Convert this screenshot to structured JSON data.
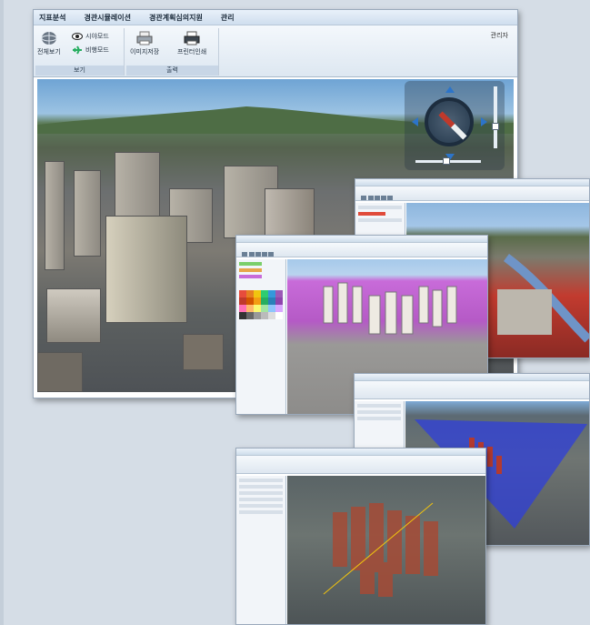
{
  "main_window": {
    "menu": [
      "지표분석",
      "경관시뮬레이션",
      "경관계획심의지원",
      "관리"
    ],
    "user_label": "관리자",
    "ribbon": {
      "view_group": {
        "caption": "보기",
        "full_view": "전체보기",
        "sight_mode": "시야모드",
        "flight_mode": "비행모드"
      },
      "output_group": {
        "caption": "출력",
        "save_image": "이미지저장",
        "print": "프린터인쇄"
      }
    }
  },
  "icons": {
    "full_view": "globe-icon",
    "sight_mode": "eye-icon",
    "flight_mode": "airplane-icon",
    "save_image": "printer-icon",
    "print": "printer-icon",
    "navigation": "compass-icon"
  },
  "colors": {
    "menubar_bg": "#d9e6f3",
    "ribbon_caption": "#c8d6e6",
    "highlight_purple": "#c86bd9",
    "highlight_red": "#d93a2f",
    "highlight_blue": "#2f3fd9"
  }
}
